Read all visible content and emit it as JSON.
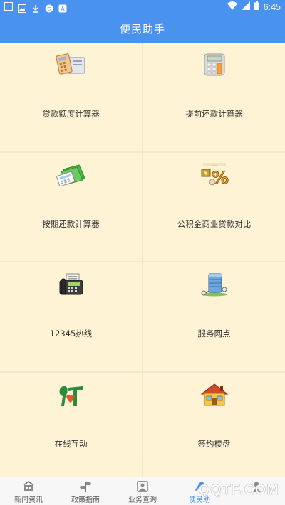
{
  "status_bar": {
    "time": "6:45",
    "icons": [
      "square-icon",
      "gallery-icon",
      "download-icon",
      "circle-badge-icon",
      "a-badge-icon",
      "wifi-icon",
      "signal-icon",
      "battery-icon"
    ]
  },
  "header": {
    "title": "便民助手"
  },
  "tools": [
    {
      "label": "贷款额度计算器",
      "icon": "loan-calculator-icon"
    },
    {
      "label": "提前还款计算器",
      "icon": "calculator-icon"
    },
    {
      "label": "按期还款计算器",
      "icon": "money-stack-icon"
    },
    {
      "label": "公积金商业贷款对比",
      "icon": "percent-comparison-icon"
    },
    {
      "label": "12345热线",
      "icon": "fax-phone-icon"
    },
    {
      "label": "服务网点",
      "icon": "server-network-icon"
    },
    {
      "label": "在线互动",
      "icon": "interaction-logo-icon"
    },
    {
      "label": "签约楼盘",
      "icon": "house-icon"
    }
  ],
  "bottom_nav": [
    {
      "label": "新闻资讯",
      "icon": "newspaper-icon",
      "active": false
    },
    {
      "label": "政策指南",
      "icon": "guide-icon",
      "active": false
    },
    {
      "label": "业务查询",
      "icon": "query-icon",
      "active": false
    },
    {
      "label": "便民助",
      "icon": "helper-icon",
      "active": true
    },
    {
      "label": "",
      "icon": "person-icon",
      "active": false
    }
  ],
  "watermark": "QQTF.COM",
  "colors": {
    "accent": "#4A92F0",
    "tile_bg": "#FFF3D6"
  }
}
